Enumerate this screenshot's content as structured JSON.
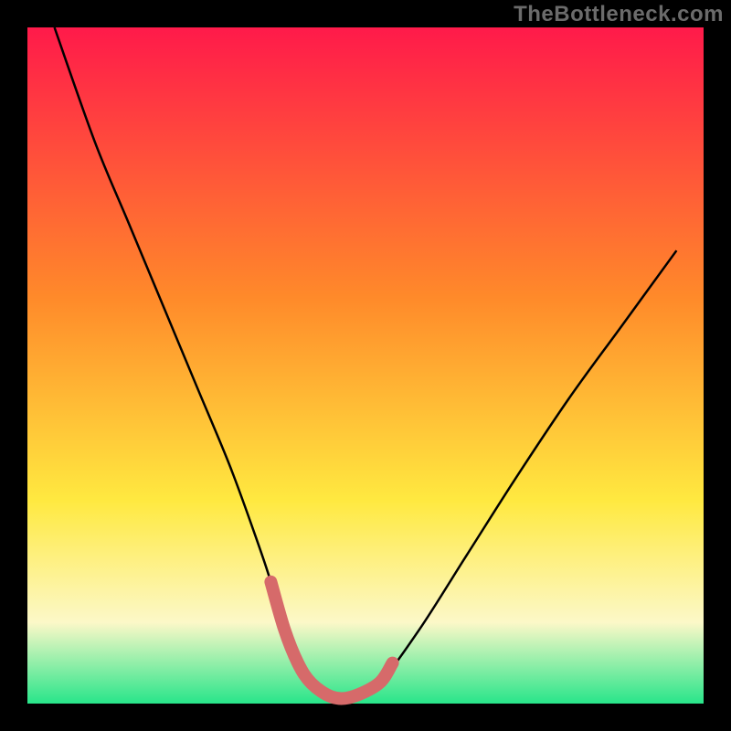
{
  "watermark": "TheBottleneck.com",
  "colors": {
    "gradient_top": "#ff1a4a",
    "gradient_mid1": "#ff8a2a",
    "gradient_mid2": "#ffe940",
    "gradient_pale": "#fcf8c8",
    "gradient_green": "#28e58a",
    "curve": "#000000",
    "accent": "#d66a6a",
    "frame": "#000000"
  },
  "chart_data": {
    "type": "line",
    "title": "",
    "xlabel": "",
    "ylabel": "",
    "xlim": [
      0,
      100
    ],
    "ylim": [
      0,
      100
    ],
    "series": [
      {
        "name": "bottleneck-curve",
        "x": [
          4,
          10,
          15,
          20,
          25,
          30,
          34,
          36,
          38,
          40,
          42,
          45,
          48,
          52,
          58,
          65,
          72,
          80,
          88,
          96
        ],
        "y": [
          100,
          83,
          71,
          59,
          47,
          35,
          24,
          18,
          11,
          6,
          3,
          1,
          1,
          3,
          11,
          22,
          33,
          45,
          56,
          67
        ]
      }
    ],
    "accent_segment": {
      "name": "valley-highlight",
      "x": [
        36,
        38,
        40,
        42,
        45,
        48,
        52,
        54
      ],
      "y": [
        18,
        11,
        6,
        3,
        1,
        1,
        3,
        6
      ]
    }
  }
}
